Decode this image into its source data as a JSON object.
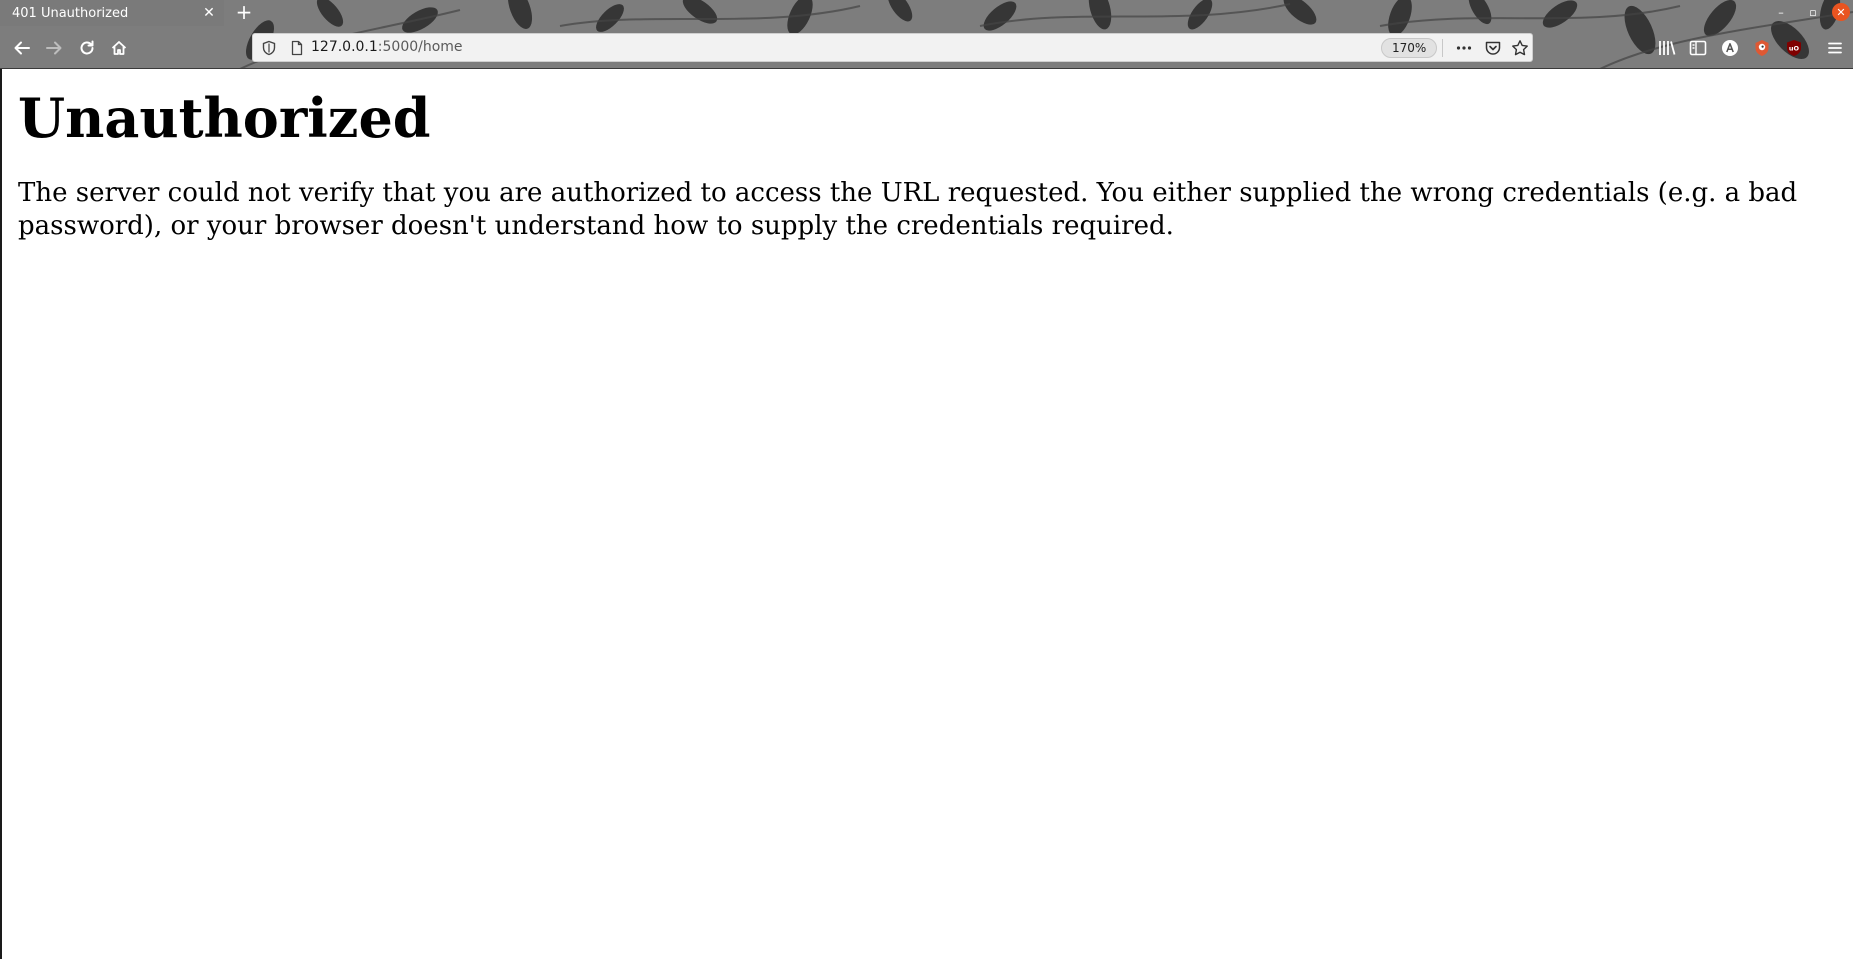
{
  "browser": {
    "tab": {
      "title": "401 Unauthorized",
      "close_glyph": "✕"
    },
    "new_tab_glyph": "+",
    "window_controls": {
      "minimize": "–",
      "maximize": "▫",
      "close": "✕"
    },
    "url": {
      "host": "127.0.0.1",
      "rest": ":5000/home"
    },
    "zoom": "170%",
    "icons": {
      "back": "arrow-left-icon",
      "forward": "arrow-right-icon",
      "reload": "reload-icon",
      "home": "home-icon",
      "tracking": "shield-icon",
      "page_info": "page-icon",
      "page_actions": "more-dots-icon",
      "pocket": "pocket-icon",
      "bookmark": "star-icon",
      "library": "library-icon",
      "sidebar": "sidebar-icon",
      "extension_a": "extension-a-icon",
      "extension_duckduckgo": "duckduckgo-icon",
      "extension_ublock": "ublock-origin-icon",
      "menu": "hamburger-menu-icon"
    },
    "colors": {
      "chrome": "#7a7a7a",
      "close_button": "#e95420",
      "ublock": "#800000"
    }
  },
  "page": {
    "heading": "Unauthorized",
    "message": "The server could not verify that you are authorized to access the URL requested. You either supplied the wrong credentials (e.g. a bad password), or your browser doesn't understand how to supply the credentials required."
  }
}
